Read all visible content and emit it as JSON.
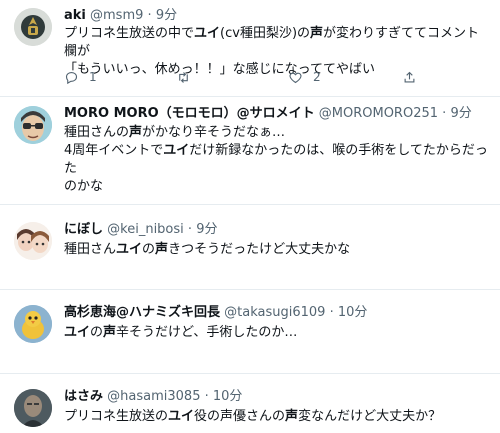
{
  "tweets": [
    {
      "name": "aki",
      "handle": "@msm9",
      "sep": "·",
      "time": "9分",
      "lines": [
        [
          [
            "プリコネ生放送の中で",
            false
          ],
          [
            "ユイ",
            true
          ],
          [
            "(cv種田梨沙)の",
            false
          ],
          [
            "声",
            true
          ],
          [
            "が変わりすぎててコメント欄が",
            false
          ]
        ],
        [
          [
            "「もういいっ、休めっ！！」な感じになっててやばい",
            false
          ]
        ]
      ],
      "reply_count": "1",
      "like_count": "2"
    },
    {
      "name": "MORO MORO（モロモロ）@サロメイト",
      "handle": "@MOROMORO251",
      "sep": "·",
      "time": "9分",
      "lines": [
        [
          [
            "種田さんの",
            false
          ],
          [
            "声",
            true
          ],
          [
            "がかなり辛そうだなぁ…",
            false
          ]
        ],
        [
          [
            "4周年イベントで",
            false
          ],
          [
            "ユイ",
            true
          ],
          [
            "だけ新録なかったのは、喉の手術をしてたからだった",
            false
          ]
        ],
        [
          [
            "のかな",
            false
          ]
        ]
      ]
    },
    {
      "name": "にぼし",
      "handle": "@kei_nibosi",
      "sep": "·",
      "time": "9分",
      "lines": [
        [
          [
            "種田さん",
            false
          ],
          [
            "ユイ",
            true
          ],
          [
            "の",
            false
          ],
          [
            "声",
            true
          ],
          [
            "きつそうだったけど大丈夫かな",
            false
          ]
        ]
      ]
    },
    {
      "name": "高杉恵海@ハナミズキ回長",
      "handle": "@takasugi6109",
      "sep": "·",
      "time": "10分",
      "lines": [
        [
          [
            "ユイ",
            true
          ],
          [
            "の",
            false
          ],
          [
            "声",
            true
          ],
          [
            "辛そうだけど、手術したのか…",
            false
          ]
        ]
      ]
    },
    {
      "name": "はさみ",
      "handle": "@hasami3085",
      "sep": "·",
      "time": "10分",
      "lines": [
        [
          [
            "プリコネ生放送の",
            false
          ],
          [
            "ユイ",
            true
          ],
          [
            "役の声優さんの",
            false
          ],
          [
            "声",
            true
          ],
          [
            "変なんだけど大丈夫か？",
            false
          ]
        ]
      ]
    }
  ],
  "icons": [
    "reply-icon",
    "retweet-icon",
    "like-icon",
    "share-icon"
  ]
}
